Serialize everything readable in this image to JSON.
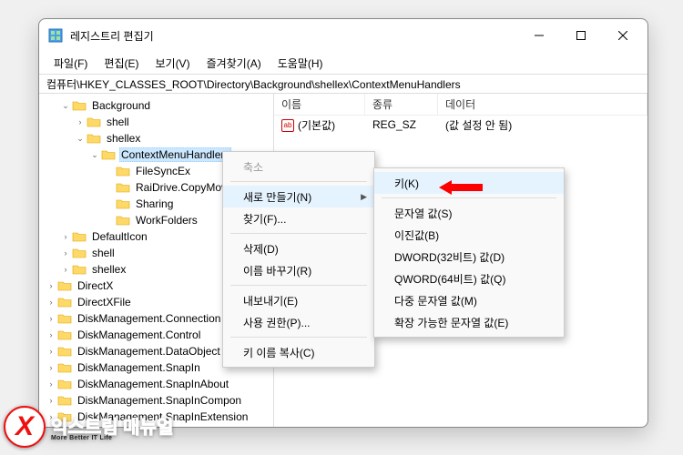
{
  "window": {
    "title": "레지스트리 편집기"
  },
  "menubar": {
    "file": "파일(F)",
    "edit": "편집(E)",
    "view": "보기(V)",
    "favorites": "즐겨찾기(A)",
    "help": "도움말(H)"
  },
  "addressbar": {
    "path": "컴퓨터\\HKEY_CLASSES_ROOT\\Directory\\Background\\shellex\\ContextMenuHandlers"
  },
  "tree": {
    "items": [
      {
        "indent": 1,
        "expander": "v",
        "label": "Background"
      },
      {
        "indent": 2,
        "expander": ">",
        "label": "shell"
      },
      {
        "indent": 2,
        "expander": "v",
        "label": "shellex"
      },
      {
        "indent": 3,
        "expander": "v",
        "label": "ContextMenuHandlers",
        "selected": true
      },
      {
        "indent": 4,
        "expander": "",
        "label": "FileSyncEx"
      },
      {
        "indent": 4,
        "expander": "",
        "label": "RaiDrive.CopyMove"
      },
      {
        "indent": 4,
        "expander": "",
        "label": "Sharing"
      },
      {
        "indent": 4,
        "expander": "",
        "label": "WorkFolders"
      },
      {
        "indent": 1,
        "expander": ">",
        "label": "DefaultIcon"
      },
      {
        "indent": 1,
        "expander": ">",
        "label": "shell"
      },
      {
        "indent": 1,
        "expander": ">",
        "label": "shellex"
      },
      {
        "indent": 0,
        "expander": ">",
        "label": "DirectX"
      },
      {
        "indent": 0,
        "expander": ">",
        "label": "DirectXFile"
      },
      {
        "indent": 0,
        "expander": ">",
        "label": "DiskManagement.Connection"
      },
      {
        "indent": 0,
        "expander": ">",
        "label": "DiskManagement.Control"
      },
      {
        "indent": 0,
        "expander": ">",
        "label": "DiskManagement.DataObject"
      },
      {
        "indent": 0,
        "expander": ">",
        "label": "DiskManagement.SnapIn"
      },
      {
        "indent": 0,
        "expander": ">",
        "label": "DiskManagement.SnapInAbout"
      },
      {
        "indent": 0,
        "expander": ">",
        "label": "DiskManagement.SnapInCompon"
      },
      {
        "indent": 0,
        "expander": ">",
        "label": "DiskManagement.SnapInExtension"
      }
    ]
  },
  "list": {
    "columns": {
      "name": "이름",
      "type": "종류",
      "data": "데이터"
    },
    "rows": [
      {
        "icon": "ab",
        "name": "(기본값)",
        "type": "REG_SZ",
        "data": "(값 설정 안 됨)"
      }
    ]
  },
  "ctx1": {
    "collapse": "축소",
    "new": "새로 만들기(N)",
    "find": "찾기(F)...",
    "delete": "삭제(D)",
    "rename": "이름 바꾸기(R)",
    "export": "내보내기(E)",
    "permissions": "사용 권한(P)...",
    "copyKeyName": "키 이름 복사(C)"
  },
  "ctx2": {
    "key": "키(K)",
    "string": "문자열 값(S)",
    "binary": "이진값(B)",
    "dword": "DWORD(32비트) 값(D)",
    "qword": "QWORD(64비트) 값(Q)",
    "multistring": "다중 문자열 값(M)",
    "expandstring": "확장 가능한 문자열 값(E)"
  },
  "logo": {
    "main": "익스트림 매뉴얼",
    "sub": "More Better IT Life"
  }
}
